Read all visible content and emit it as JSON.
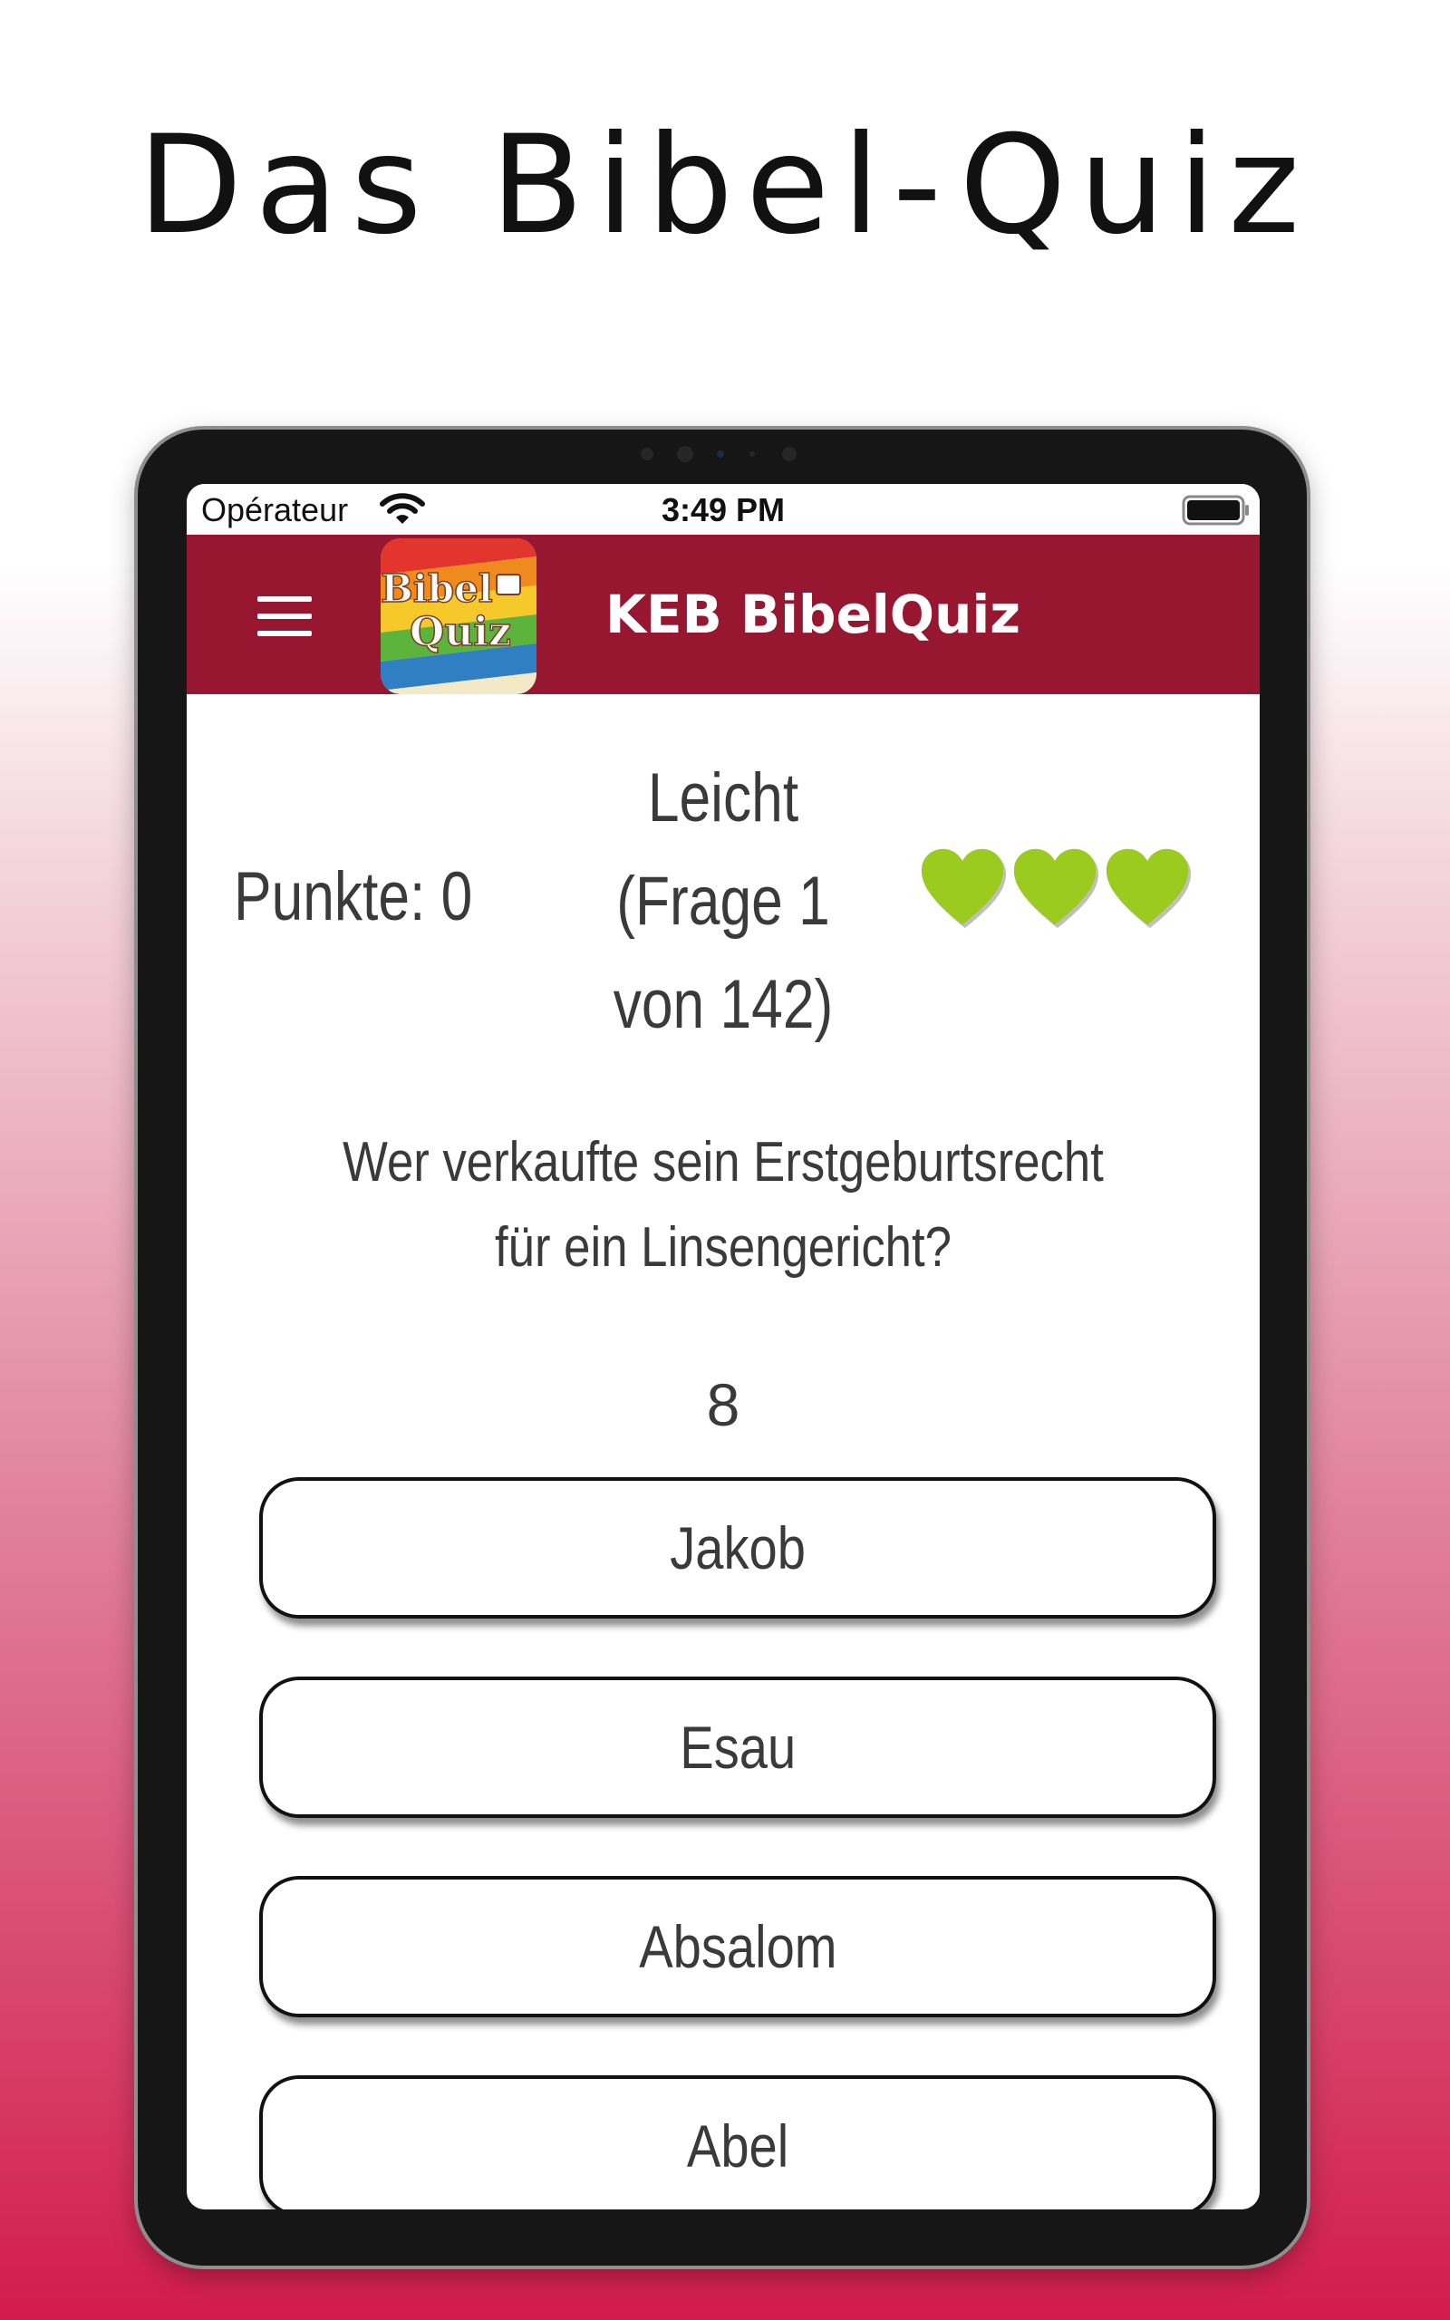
{
  "promo": {
    "headline": "Das Bibel-Quiz"
  },
  "status_bar": {
    "carrier": "Opérateur",
    "time": "3:49 PM"
  },
  "app_bar": {
    "title": "KEB BibelQuiz",
    "logo_text_line1": "Bibel",
    "logo_text_line2": "Quiz",
    "color": "#981730"
  },
  "game": {
    "score_label": "Punkte: 0",
    "level_line1": "Leicht",
    "level_line2": "(Frage 1",
    "level_line3": "von 142)",
    "lives": 3,
    "heart_color": "#9ccb1f",
    "question": "Wer verkaufte sein Erstgeburtsrecht für ein Linsengericht?",
    "timer": "8",
    "answers": [
      {
        "label": "Jakob"
      },
      {
        "label": "Esau"
      },
      {
        "label": "Absalom"
      },
      {
        "label": "Abel"
      }
    ]
  },
  "icons": [
    "menu-icon",
    "wifi-icon",
    "battery-icon",
    "heart-icon",
    "app-logo-icon"
  ]
}
